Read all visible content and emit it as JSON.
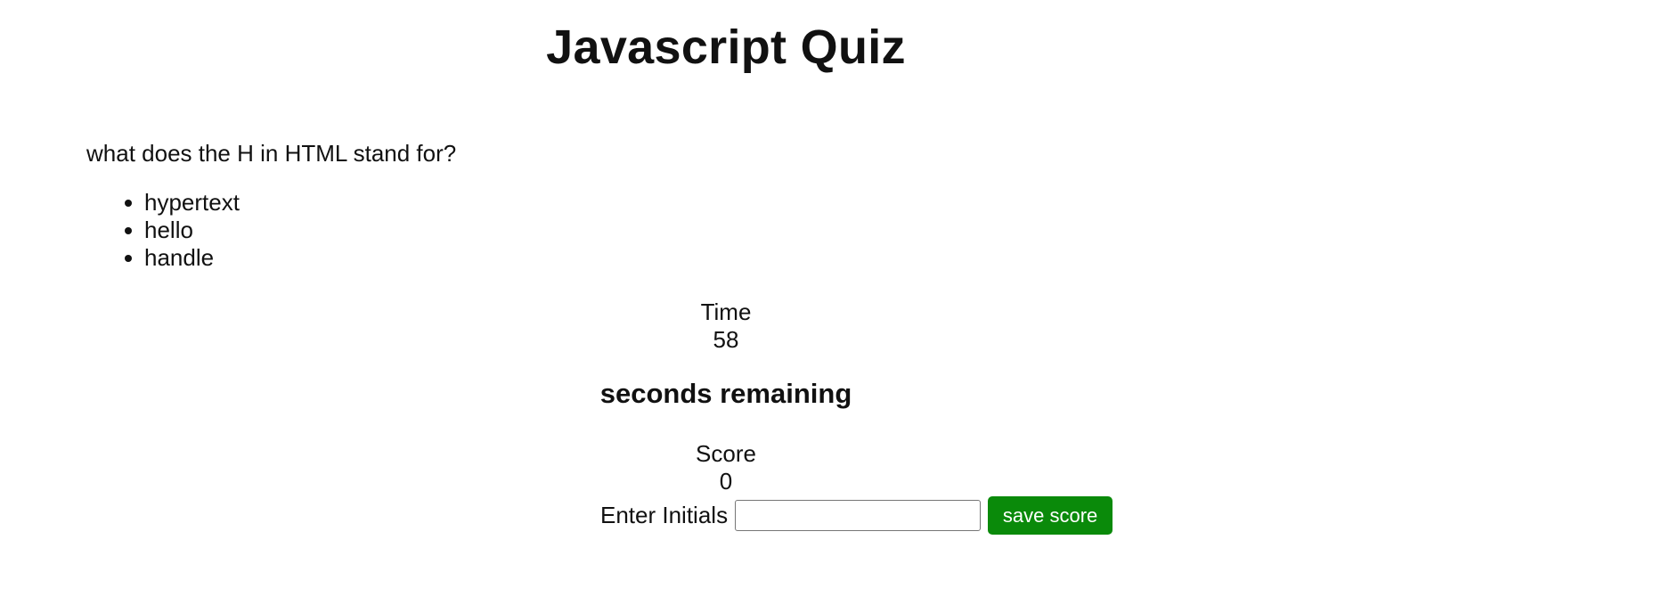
{
  "header": {
    "title": "Javascript Quiz"
  },
  "quiz": {
    "question": "what does the H in HTML stand for?",
    "answers": [
      "hypertext",
      "hello",
      "handle"
    ]
  },
  "timer": {
    "label": "Time",
    "value": "58",
    "suffix": "seconds remaining"
  },
  "score": {
    "label": "Score",
    "value": "0"
  },
  "save_form": {
    "initials_label": "Enter Initials",
    "initials_value": "",
    "initials_placeholder": "",
    "button_label": "save score"
  },
  "colors": {
    "button_bg": "#0a8a0a",
    "button_text": "#ffffff"
  }
}
